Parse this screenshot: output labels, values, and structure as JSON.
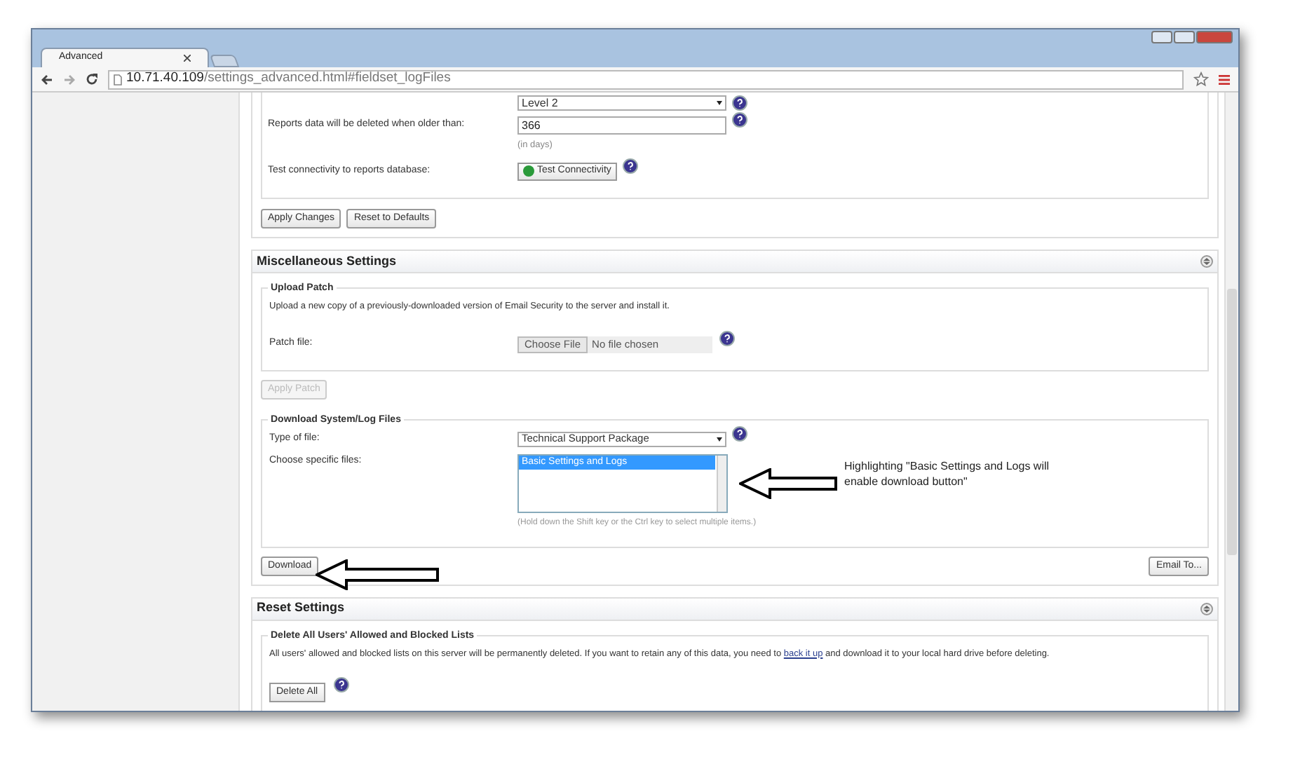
{
  "browser": {
    "tab_title": "Advanced",
    "address_host": "10.71.40.109",
    "address_path": "/settings_advanced.html#fieldset_logFiles"
  },
  "reports": {
    "log_level": "Level 2",
    "deleted_label": "Reports data will be deleted when older than:",
    "deleted_value": "366",
    "deleted_hint": "(in days)",
    "test_label": "Test connectivity to reports database:",
    "test_button": "Test Connectivity",
    "buttons": [
      {
        "label": "Apply Changes",
        "disabled": false
      },
      {
        "label": "Reset to Defaults",
        "disabled": false
      }
    ]
  },
  "misc": {
    "title": "Miscellaneous Settings",
    "upload": {
      "legend": "Upload Patch",
      "description": "Upload a new copy of a previously-downloaded version of Email Security to the server and install it.",
      "patch_label": "Patch file:",
      "choose_button": "Choose File",
      "file_status": "No file chosen"
    },
    "apply_patch": {
      "label": "Apply Patch",
      "disabled": true
    },
    "download": {
      "legend": "Download System/Log Files",
      "type_label": "Type of file:",
      "type_value": "Technical Support Package",
      "files_label": "Choose specific files:",
      "files": [
        {
          "label": "Basic Settings and Logs",
          "selected": true
        }
      ],
      "files_hint": "(Hold down the Shift key or the Ctrl key to select multiple items.)"
    },
    "download_button": {
      "label": "Download",
      "disabled": false
    },
    "email_button": {
      "label": "Email To...",
      "disabled": false
    }
  },
  "reset": {
    "title": "Reset Settings",
    "legend": "Delete All Users' Allowed and Blocked Lists",
    "text_before": "All users' allowed and blocked lists on this server will be permanently deleted. If you want to retain any of this data, you need to ",
    "link": "back it up",
    "text_after": " and download it to your local hard drive before deleting.",
    "delete_button": "Delete All"
  },
  "annotation": {
    "note": "Highlighting \"Basic Settings and Logs will enable download button\""
  }
}
